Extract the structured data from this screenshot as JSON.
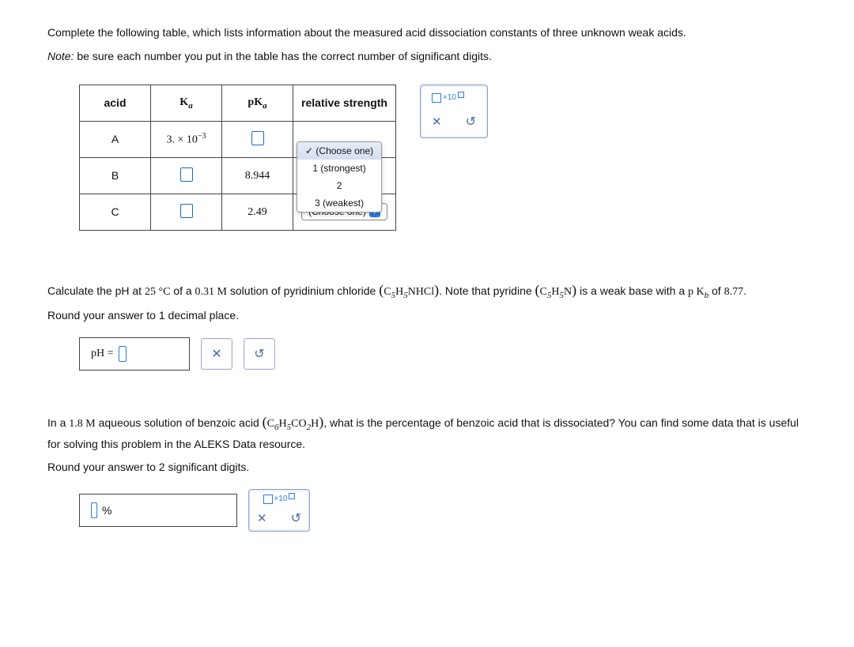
{
  "q1": {
    "intro": "Complete the following table, which lists information about the measured acid dissociation constants of three unknown weak acids.",
    "note_prefix": "Note:",
    "note_rest": " be sure each number you put in the table has the correct number of significant digits.",
    "headers": {
      "acid": "acid",
      "ka_base": "K",
      "ka_sub": "a",
      "pka_base": "pK",
      "pka_sub": "a",
      "rel": "relative strength"
    },
    "rows": [
      {
        "acid": "A",
        "ka_pre": "3. × 10",
        "ka_exp": "−3",
        "pka": "",
        "rel": "choose-open"
      },
      {
        "acid": "B",
        "pka": "8.944",
        "rel": "hidden"
      },
      {
        "acid": "C",
        "pka": "2.49",
        "rel": "choose"
      }
    ],
    "dropdown": {
      "head_check": "✓",
      "head_label": "(Choose one)",
      "opt1": "1 (strongest)",
      "opt2": "2",
      "opt3": "3 (weakest)"
    },
    "chooser_label": "(Choose one)",
    "sci_label": "×10"
  },
  "q2": {
    "text_a": "Calculate the pH at ",
    "temp": "25 °C",
    "text_b": " of a ",
    "conc": "0.31 M",
    "text_c": " solution of pyridinium chloride ",
    "formula1_a": "C",
    "formula1_b": "5",
    "formula1_c": "H",
    "formula1_d": "5",
    "formula1_e": "NHCl",
    "text_d": ". Note that pyridine ",
    "formula2_a": "C",
    "formula2_b": "5",
    "formula2_c": "H",
    "formula2_d": "5",
    "formula2_e": "N",
    "text_e": " is a weak base with a ",
    "pkb_pre": "p K",
    "pkb_sub": "b",
    "text_f": " of ",
    "pkb_val": "8.77",
    "text_g": ".",
    "round": "Round your answer to 1 decimal place.",
    "ph_label": "pH ="
  },
  "q3": {
    "text_a": "In a ",
    "conc": "1.8 M",
    "text_b": " aqueous solution of benzoic acid ",
    "formula_a": "C",
    "formula_b": "6",
    "formula_c": "H",
    "formula_d": "5",
    "formula_e": "CO",
    "formula_f": "2",
    "formula_g": "H",
    "text_c": ", what is the percentage of benzoic acid that is dissociated? You can find some data that is useful for solving this problem in the ALEKS Data resource.",
    "round": "Round your answer to 2 significant digits.",
    "pct": "%",
    "sci_label": "×10"
  }
}
